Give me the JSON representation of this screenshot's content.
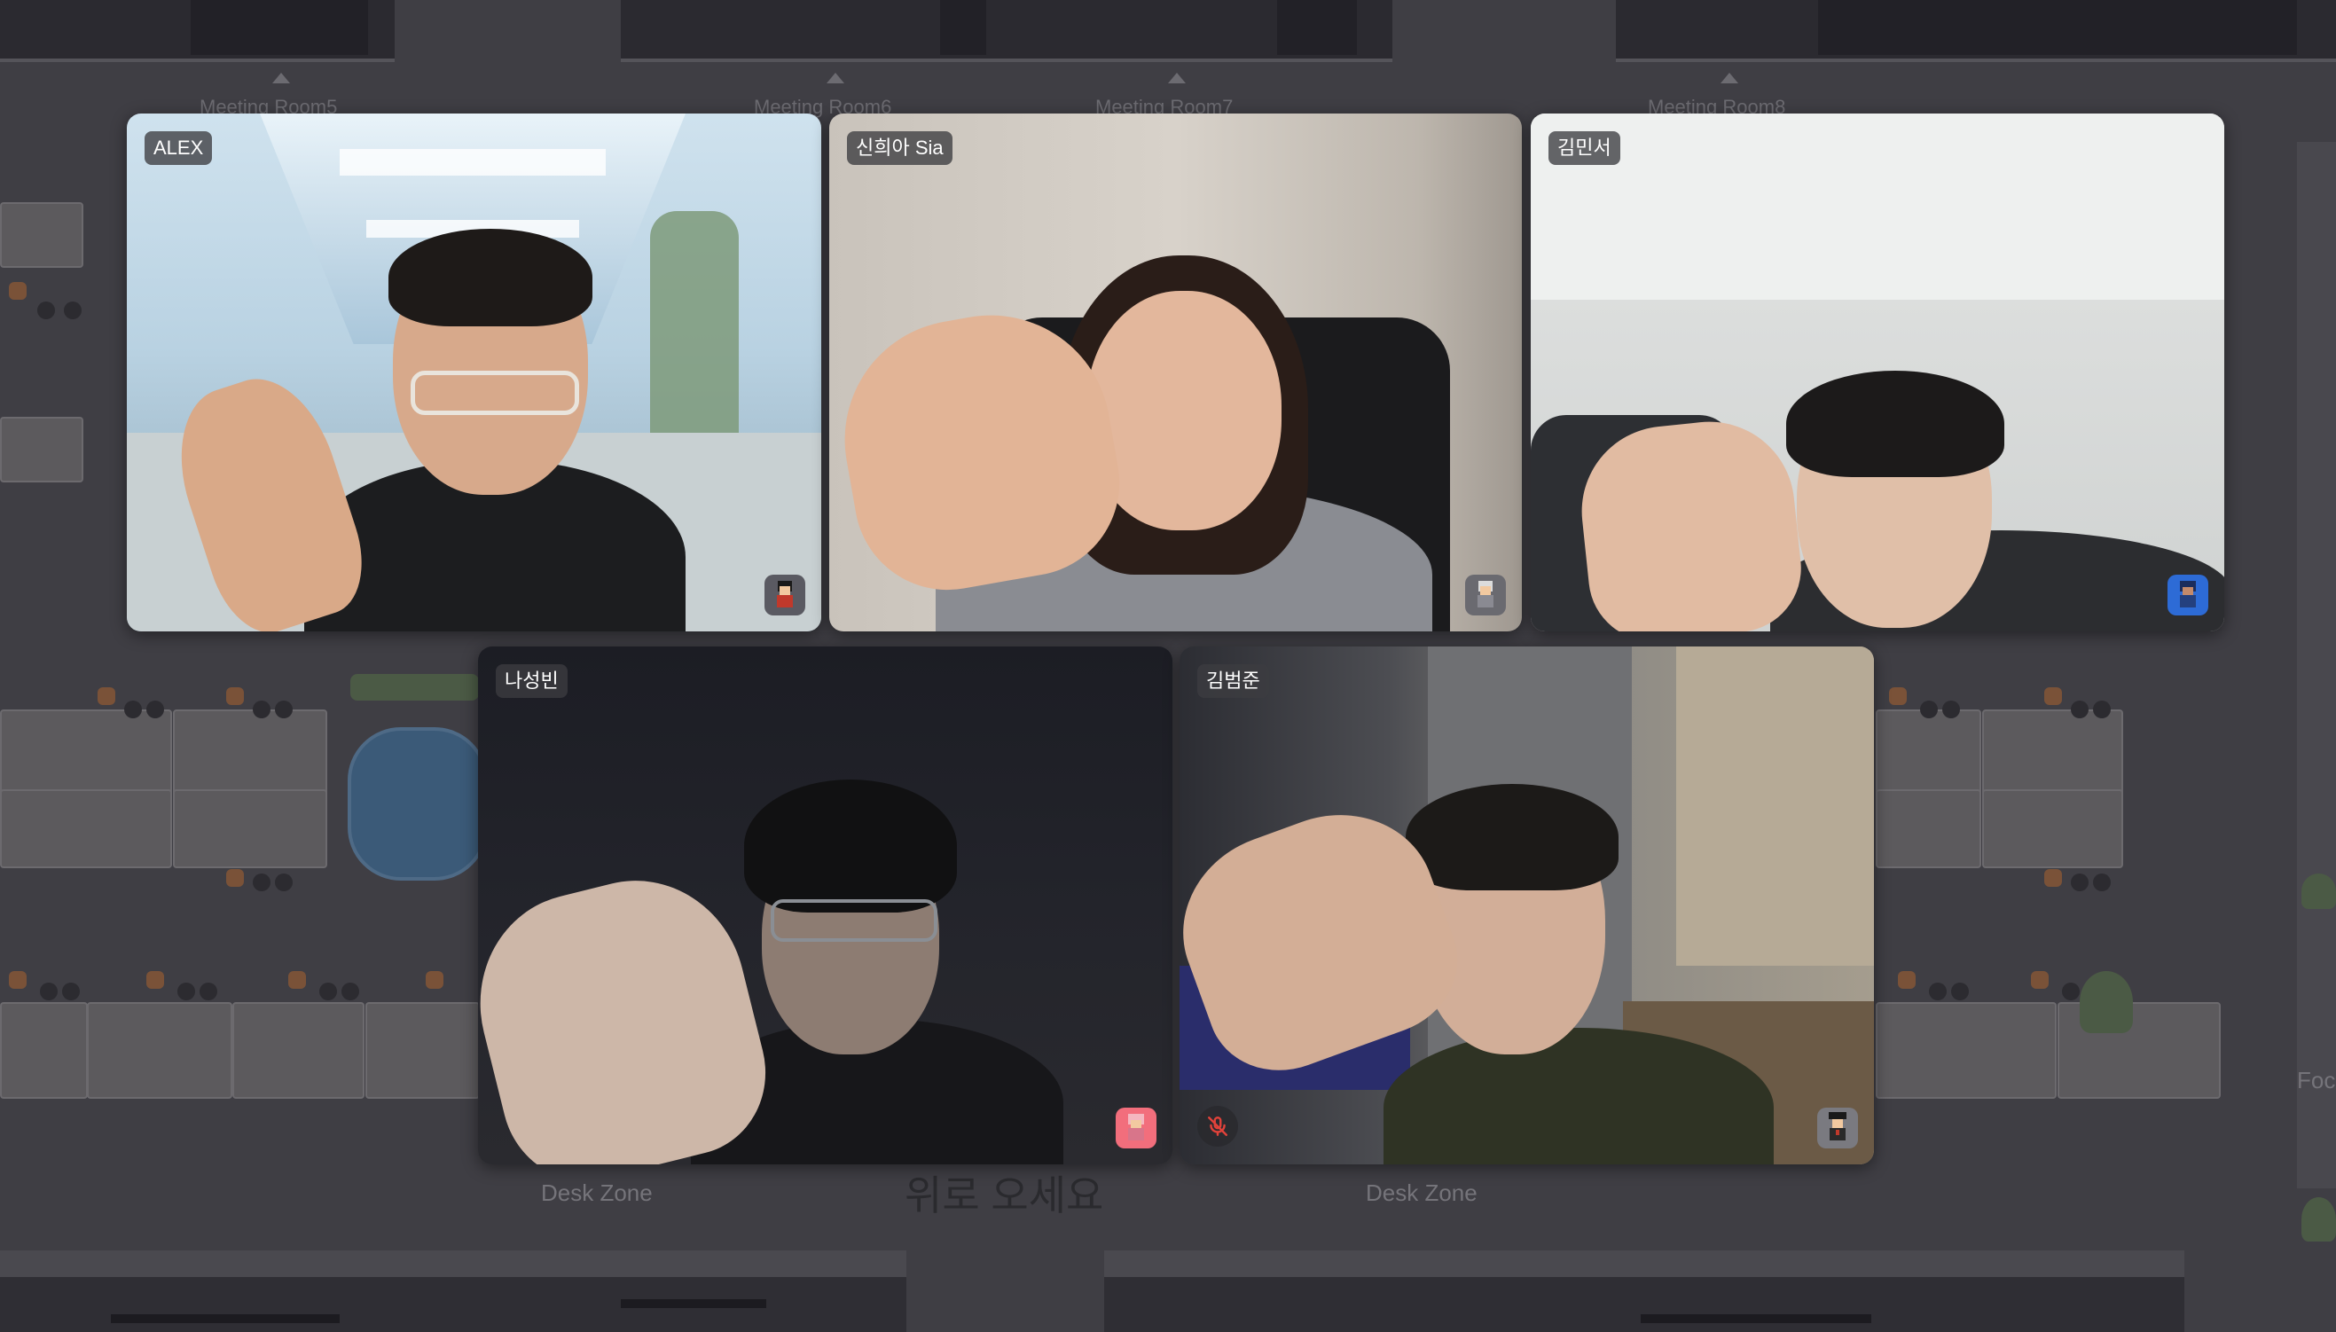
{
  "background_map": {
    "room_labels": [
      "Meeting Room5",
      "Meeting Room6",
      "Meeting Room7",
      "Meeting Room8"
    ],
    "zone_labels": [
      "Desk Zone",
      "Desk Zone"
    ],
    "floor_sign": "위로 오세요",
    "partial_label_right": "Foc"
  },
  "participants": [
    {
      "name": "ALEX",
      "avatar": "avatar-red-character-icon",
      "muted": false
    },
    {
      "name": "신희아 Sia",
      "avatar": "avatar-gray-character-icon",
      "muted": false
    },
    {
      "name": "김민서",
      "avatar": "avatar-blue-character-icon",
      "muted": false
    },
    {
      "name": "나성빈",
      "avatar": "avatar-pink-character-icon",
      "muted": false
    },
    {
      "name": "김범준",
      "avatar": "avatar-dark-character-icon",
      "muted": true
    }
  ],
  "colors": {
    "name_tag_bg": "#3c3c40",
    "mute_icon": "#e0423a"
  }
}
